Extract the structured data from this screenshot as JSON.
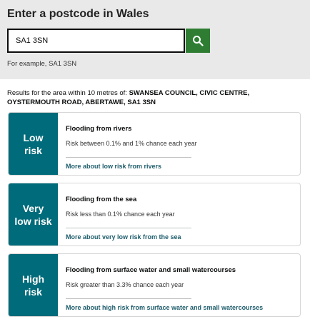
{
  "search": {
    "title": "Enter a postcode in Wales",
    "input_value": "SA1 3SN",
    "hint": "For example, SA1 3SN",
    "button_icon": "search-icon",
    "button_color": "#2e7d32"
  },
  "results": {
    "prefix": "Results for the area within 10 metres of:",
    "address": "SWANSEA COUNCIL, CIVIC CENTRE, OYSTERMOUTH ROAD, ABERTAWE, SA1 3SN"
  },
  "cards": [
    {
      "risk_line1": "Low",
      "risk_line2": "risk",
      "title": "Flooding from rivers",
      "chance": "Risk between 0.1% and 1% chance each year",
      "link": "More about low risk from rivers"
    },
    {
      "risk_line1": "Very",
      "risk_line2": "low risk",
      "title": "Flooding from the sea",
      "chance": "Risk less than 0.1% chance each year",
      "link": "More about very low risk from the sea"
    },
    {
      "risk_line1": "High",
      "risk_line2": "risk",
      "title": "Flooding from surface water and small watercourses",
      "chance": "Risk greater than 3.3% chance each year",
      "link": "More about high risk from surface water and small watercourses"
    }
  ],
  "colors": {
    "risk_block": "#006b7a",
    "link": "#1d5c6b",
    "panel": "#e9e9e9"
  }
}
